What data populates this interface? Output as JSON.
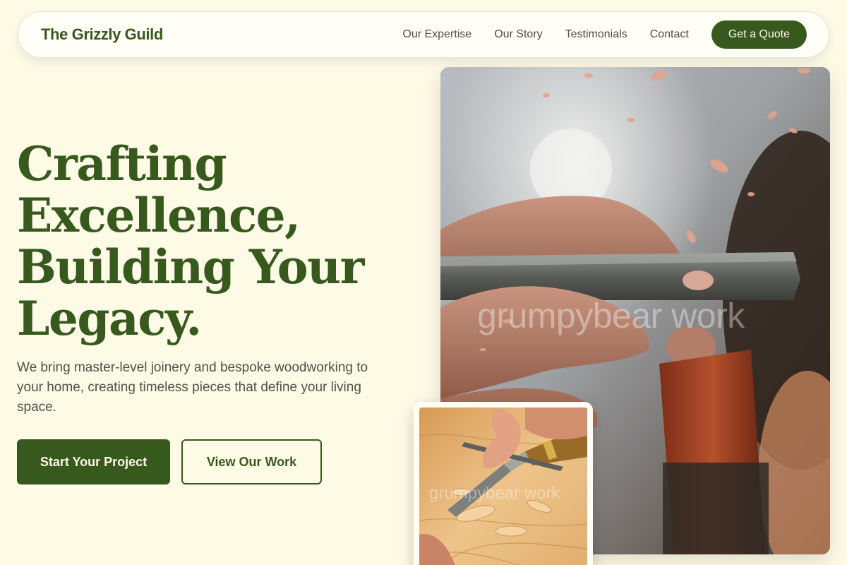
{
  "brand": {
    "name": "The Grizzly Guild"
  },
  "nav": {
    "links": [
      "Our Expertise",
      "Our Story",
      "Testimonials",
      "Contact"
    ],
    "cta_label": "Get a Quote"
  },
  "hero": {
    "title_lines": [
      "Crafting",
      "Excellence,",
      "Building Your",
      "Legacy."
    ],
    "subtitle": "We bring master-level joinery and bespoke woodworking to your home, creating timeless pieces that define your living space.",
    "primary_label": "Start Your Project",
    "secondary_label": "View Our Work"
  },
  "images": {
    "main_watermark": "grumpybear work",
    "small_watermark": "grumpybear work"
  },
  "colors": {
    "background": "#fdfae6",
    "brand_green": "#37591d",
    "body_text": "#4f5148",
    "nav_surface": "#fffef7"
  }
}
